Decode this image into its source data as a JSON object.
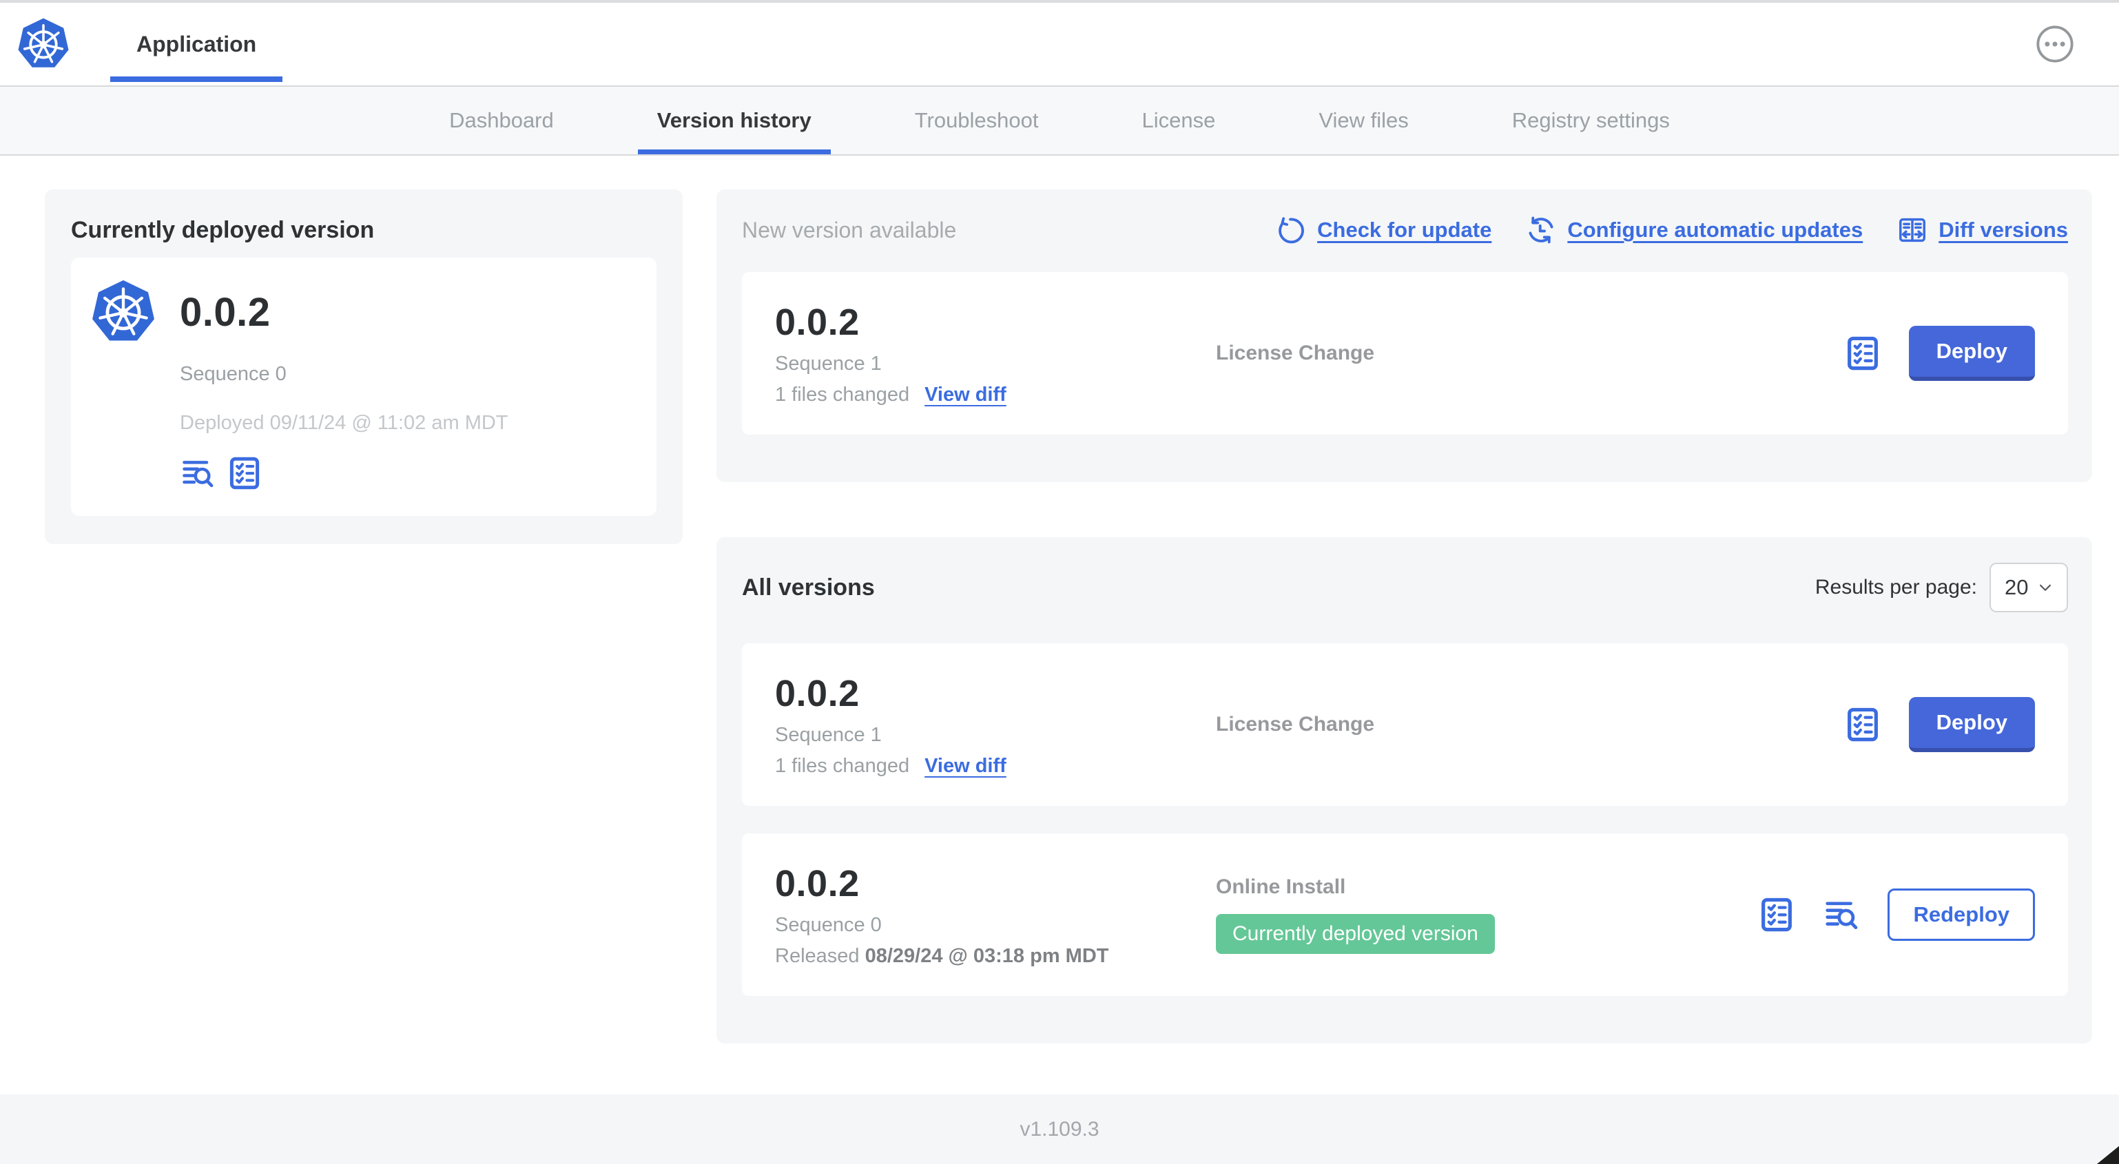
{
  "header": {
    "app_tab": "Application"
  },
  "nav": {
    "tabs": [
      {
        "label": "Dashboard",
        "active": false
      },
      {
        "label": "Version history",
        "active": true
      },
      {
        "label": "Troubleshoot",
        "active": false
      },
      {
        "label": "License",
        "active": false
      },
      {
        "label": "View files",
        "active": false
      },
      {
        "label": "Registry settings",
        "active": false
      }
    ]
  },
  "deployed": {
    "title": "Currently deployed version",
    "version": "0.0.2",
    "sequence": "Sequence 0",
    "deployed_at": "Deployed 09/11/24 @ 11:02 am MDT"
  },
  "new_version": {
    "title": "New version available",
    "check_for_update": "Check for update",
    "configure_auto": "Configure automatic updates",
    "diff_versions": "Diff versions",
    "row": {
      "version": "0.0.2",
      "sequence": "Sequence 1",
      "files_changed": "1 files changed",
      "view_diff": "View diff",
      "source": "License Change",
      "action": "Deploy"
    }
  },
  "all_versions": {
    "title": "All versions",
    "per_page_label": "Results per page:",
    "per_page_value": "20",
    "rows": [
      {
        "version": "0.0.2",
        "sequence": "Sequence 1",
        "files_changed": "1 files changed",
        "view_diff": "View diff",
        "source": "License Change",
        "action": "Deploy"
      },
      {
        "version": "0.0.2",
        "sequence": "Sequence 0",
        "released_label": "Released",
        "released_date": "08/29/24 @ 03:18 pm MDT",
        "source": "Online Install",
        "badge": "Currently deployed version",
        "action": "Redeploy"
      }
    ]
  },
  "footer": {
    "version": "v1.109.3"
  },
  "icons": {
    "app_logo": "kubernetes-logo",
    "header_right": "ellipsis-circle-icon",
    "deploy_logs": "deploy-logs-icon",
    "preflight": "preflight-checklist-icon",
    "check_update": "rotate-ccw-icon",
    "auto_update": "clock-refresh-icon",
    "diff": "diff-columns-icon",
    "select_chevron": "chevron-down-icon"
  },
  "colors": {
    "accent_blue": "#3b6ce0",
    "primary_button": "#4567d9",
    "badge_green": "#64c797",
    "section_bg": "#f4f6f8",
    "muted_text": "#9aa0a3",
    "light_text": "#c4c7ca"
  }
}
